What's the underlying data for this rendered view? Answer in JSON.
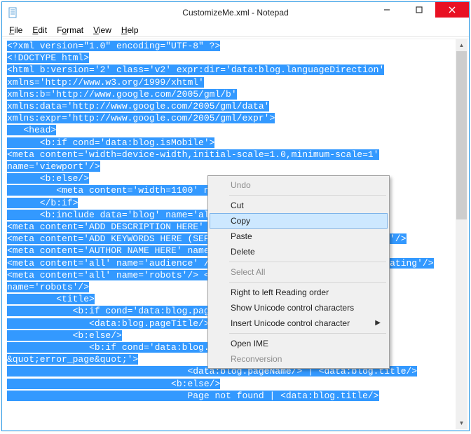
{
  "window": {
    "title": "CustomizeMe.xml - Notepad"
  },
  "menubar": {
    "file": "File",
    "edit": "Edit",
    "format": "Format",
    "view": "View",
    "help": "Help"
  },
  "editor": {
    "lines": [
      "<?xml version=\"1.0\" encoding=\"UTF-8\" ?>",
      "<!DOCTYPE html>",
      "<html b:version='2' class='v2' expr:dir='data:blog.languageDirection'",
      "xmlns='http://www.w3.org/1999/xhtml'",
      "xmlns:b='http://www.google.com/2005/gml/b'",
      "xmlns:data='http://www.google.com/2005/gml/data'",
      "xmlns:expr='http://www.google.com/2005/gml/expr'>",
      "   <head>",
      "      <b:if cond='data:blog.isMobile'>",
      "<meta content='width=device-width,initial-scale=1.0,minimum-scale=1'",
      "name='viewport'/>",
      "      <b:else/>",
      "         <meta content='width=1100' name='viewport'/>",
      "      </b:if>",
      "      <b:include data='blog' name='all-head-content'/>",
      "<meta content='ADD DESCRIPTION HERE' name='description'/>",
      "<meta content='ADD KEYWORDS HERE (SEPARATED BY COMMAS)' name='keywords'/>",
      "<meta content='AUTHOR NAME HERE' name='author'/>",
      "<meta content='all' name='audience' /> <meta content='general' name='rating'/>",
      "<meta content='all' name='robots'/> <meta content='index, follow'",
      "name='robots'/>",
      "         <title>",
      "            <b:if cond='data:blog.pageType == &quot;index&quot;'>",
      "               <data:blog.pageTitle/>",
      "            <b:else/>",
      "               <b:if cond='data:blog.pageType !=",
      "&quot;error_page&quot;'>",
      "                                 <data:blog.pageName/> | <data:blog.title/>",
      "                              <b:else/>",
      "                                 Page not found | <data:blog.title/>"
    ]
  },
  "context_menu": {
    "undo": "Undo",
    "cut": "Cut",
    "copy": "Copy",
    "paste": "Paste",
    "delete": "Delete",
    "select_all": "Select All",
    "rtl": "Right to left Reading order",
    "show_unicode": "Show Unicode control characters",
    "insert_unicode": "Insert Unicode control character",
    "open_ime": "Open IME",
    "reconversion": "Reconversion"
  }
}
